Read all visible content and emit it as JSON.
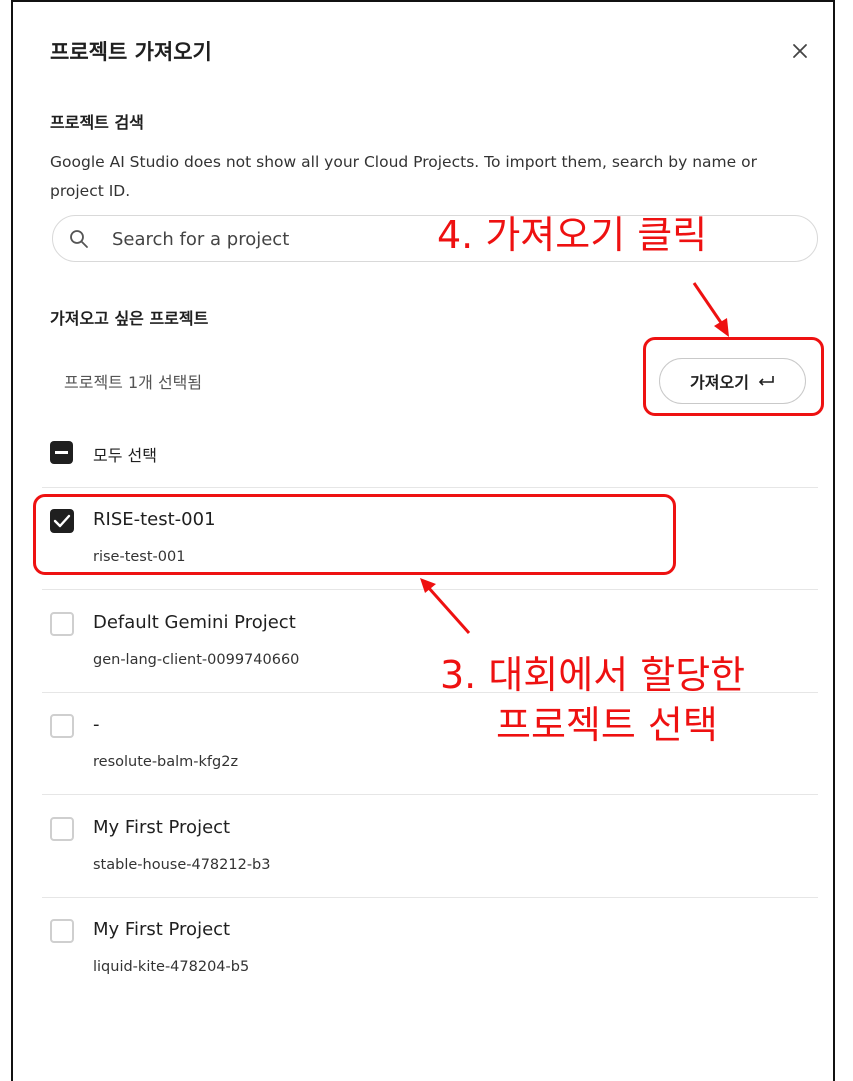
{
  "dialog": {
    "title": "프로젝트 가져오기",
    "close_icon": "close-icon"
  },
  "search": {
    "heading": "프로젝트 검색",
    "description": "Google AI Studio does not show all your Cloud Projects. To import them, search by name or project ID.",
    "placeholder": "Search for a project",
    "icon": "search-icon"
  },
  "projects_section": {
    "heading": "가져오고 싶은 프로젝트",
    "selected_count": "프로젝트 1개 선택됨",
    "import_label": "가져오기",
    "import_icon": "return-arrow-icon",
    "select_all_label": "모두 선택",
    "select_all_state": "indeterminate"
  },
  "projects": [
    {
      "name": "RISE-test-001",
      "id": "rise-test-001",
      "checked": true
    },
    {
      "name": "Default Gemini Project",
      "id": "gen-lang-client-0099740660",
      "checked": false
    },
    {
      "name": "-",
      "id": "resolute-balm-kfg2z",
      "checked": false
    },
    {
      "name": "My First Project",
      "id": "stable-house-478212-b3",
      "checked": false
    },
    {
      "name": "My First Project",
      "id": "liquid-kite-478204-b5",
      "checked": false
    }
  ],
  "annotations": {
    "step4": "4. 가져오기 클릭",
    "step3_line1": "3. 대회에서 할당한",
    "step3_line2": "프로젝트 선택",
    "color": "#ee1111"
  },
  "colors": {
    "text": "#1f1f1f",
    "checkbox_checked": "#1f1f1f",
    "checkbox_border": "#cfcfcf",
    "divider": "#e6e6e6",
    "annotation": "#ee1111"
  }
}
